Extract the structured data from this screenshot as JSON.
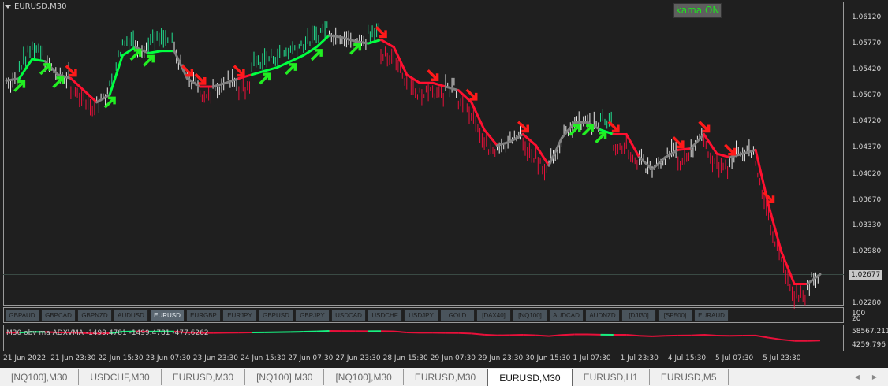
{
  "chart": {
    "title": "EURUSD,M30",
    "kama_label": "kama ON",
    "current_price": "1.02677",
    "price_ticks": [
      "1.06120",
      "1.05770",
      "1.05420",
      "1.05070",
      "1.04720",
      "1.04370",
      "1.04020",
      "1.03670",
      "1.03330",
      "1.02980",
      "1.02280"
    ],
    "price_range": [
      1.0228,
      1.0612
    ],
    "colors": {
      "up": "#00ff40",
      "down": "#ff1030",
      "neutral": "#808080",
      "up_bar": "#22e090",
      "down_bar": "#e8103a",
      "neutral_bar": "#e8e8e8"
    },
    "kama_path": [
      [
        1.0528,
        "n"
      ],
      [
        1.0531,
        "g"
      ],
      [
        1.0557,
        "g"
      ],
      [
        1.0554,
        "n"
      ],
      [
        1.0536,
        "n"
      ],
      [
        1.0531,
        "r"
      ],
      [
        1.0515,
        "r"
      ],
      [
        1.0499,
        "n"
      ],
      [
        1.0509,
        "g"
      ],
      [
        1.0562,
        "g"
      ],
      [
        1.0573,
        "n"
      ],
      [
        1.0565,
        "g"
      ],
      [
        1.0568,
        "g"
      ],
      [
        1.0568,
        "n"
      ],
      [
        1.0531,
        "n"
      ],
      [
        1.052,
        "r"
      ],
      [
        1.052,
        "n"
      ],
      [
        1.0525,
        "n"
      ],
      [
        1.0531,
        "r"
      ],
      [
        1.0536,
        "g"
      ],
      [
        1.0541,
        "g"
      ],
      [
        1.0546,
        "g"
      ],
      [
        1.0554,
        "g"
      ],
      [
        1.0562,
        "g"
      ],
      [
        1.0573,
        "g"
      ],
      [
        1.0589,
        "n"
      ],
      [
        1.0586,
        "n"
      ],
      [
        1.0581,
        "n"
      ],
      [
        1.0578,
        "g"
      ],
      [
        1.0583,
        "r"
      ],
      [
        1.0573,
        "r"
      ],
      [
        1.0536,
        "r"
      ],
      [
        1.0525,
        "r"
      ],
      [
        1.0525,
        "r"
      ],
      [
        1.052,
        "n"
      ],
      [
        1.0515,
        "r"
      ],
      [
        1.0499,
        "r"
      ],
      [
        1.0462,
        "r"
      ],
      [
        1.0441,
        "n"
      ],
      [
        1.0446,
        "n"
      ],
      [
        1.0456,
        "r"
      ],
      [
        1.0441,
        "r"
      ],
      [
        1.0414,
        "n"
      ],
      [
        1.0451,
        "n"
      ],
      [
        1.0472,
        "n"
      ],
      [
        1.0472,
        "n"
      ],
      [
        1.0462,
        "g"
      ],
      [
        1.0456,
        "r"
      ],
      [
        1.0456,
        "r"
      ],
      [
        1.0425,
        "n"
      ],
      [
        1.0409,
        "n"
      ],
      [
        1.0425,
        "n"
      ],
      [
        1.0435,
        "r"
      ],
      [
        1.0437,
        "n"
      ],
      [
        1.0456,
        "r"
      ],
      [
        1.043,
        "r"
      ],
      [
        1.0425,
        "n"
      ],
      [
        1.043,
        "n"
      ],
      [
        1.0435,
        "r"
      ],
      [
        1.0361,
        "r"
      ],
      [
        1.0298,
        "r"
      ],
      [
        1.0255,
        "r"
      ],
      [
        1.0255,
        "n"
      ],
      [
        1.0268,
        "n"
      ]
    ],
    "arrows": [
      {
        "i": 1,
        "dir": "up"
      },
      {
        "i": 3,
        "dir": "up"
      },
      {
        "i": 4,
        "dir": "up"
      },
      {
        "i": 5,
        "dir": "down"
      },
      {
        "i": 8,
        "dir": "up"
      },
      {
        "i": 10,
        "dir": "up"
      },
      {
        "i": 11,
        "dir": "up"
      },
      {
        "i": 14,
        "dir": "down"
      },
      {
        "i": 15,
        "dir": "down"
      },
      {
        "i": 18,
        "dir": "down"
      },
      {
        "i": 20,
        "dir": "up"
      },
      {
        "i": 22,
        "dir": "up"
      },
      {
        "i": 24,
        "dir": "up"
      },
      {
        "i": 27,
        "dir": "up"
      },
      {
        "i": 29,
        "dir": "down"
      },
      {
        "i": 33,
        "dir": "down"
      },
      {
        "i": 36,
        "dir": "down"
      },
      {
        "i": 40,
        "dir": "down"
      },
      {
        "i": 44,
        "dir": "up"
      },
      {
        "i": 45,
        "dir": "up"
      },
      {
        "i": 46,
        "dir": "up"
      },
      {
        "i": 47,
        "dir": "down"
      },
      {
        "i": 52,
        "dir": "down"
      },
      {
        "i": 54,
        "dir": "down"
      },
      {
        "i": 56,
        "dir": "down"
      },
      {
        "i": 59,
        "dir": "down"
      }
    ]
  },
  "symbol_buttons": [
    "GBPAUD",
    "GBPCAD",
    "GBPNZD",
    "AUDUSD",
    "EURUSD",
    "EURGBP",
    "EURJPY",
    "GBPUSD",
    "GBPJPY",
    "USDCAD",
    "USDCHF",
    "USDJPY",
    "GOLD",
    "[DAX40]",
    "[NQ100]",
    "AUDCAD",
    "AUDNZD",
    "[DJI30]",
    "[SP500]",
    "EURAUD"
  ],
  "active_symbol": "EURUSD",
  "button_axis": [
    "100",
    "20"
  ],
  "indicator": {
    "label": "M30 obv ma  ADXVMA  -1499.4781 -1499.4781 -477.6262",
    "axis": [
      "58567.211",
      "4259.796"
    ]
  },
  "time_labels": [
    "21 Jun 2022",
    "21 Jun 23:30",
    "22 Jun 15:30",
    "23 Jun 07:30",
    "23 Jun 23:30",
    "24 Jun 15:30",
    "27 Jun 07:30",
    "27 Jun 23:30",
    "28 Jun 15:30",
    "29 Jun 07:30",
    "29 Jun 23:30",
    "30 Jun 15:30",
    "1 Jul 07:30",
    "1 Jul 23:30",
    "4 Jul 15:30",
    "5 Jul 07:30",
    "5 Jul 23:30"
  ],
  "tabs": [
    "[NQ100],M30",
    "USDCHF,M30",
    "EURUSD,M30",
    "[NQ100],M30",
    "[NQ100],M30",
    "EURUSD,M30",
    "EURUSD,M30",
    "EURUSD,H1",
    "EURUSD,M5"
  ],
  "active_tab": 6
}
